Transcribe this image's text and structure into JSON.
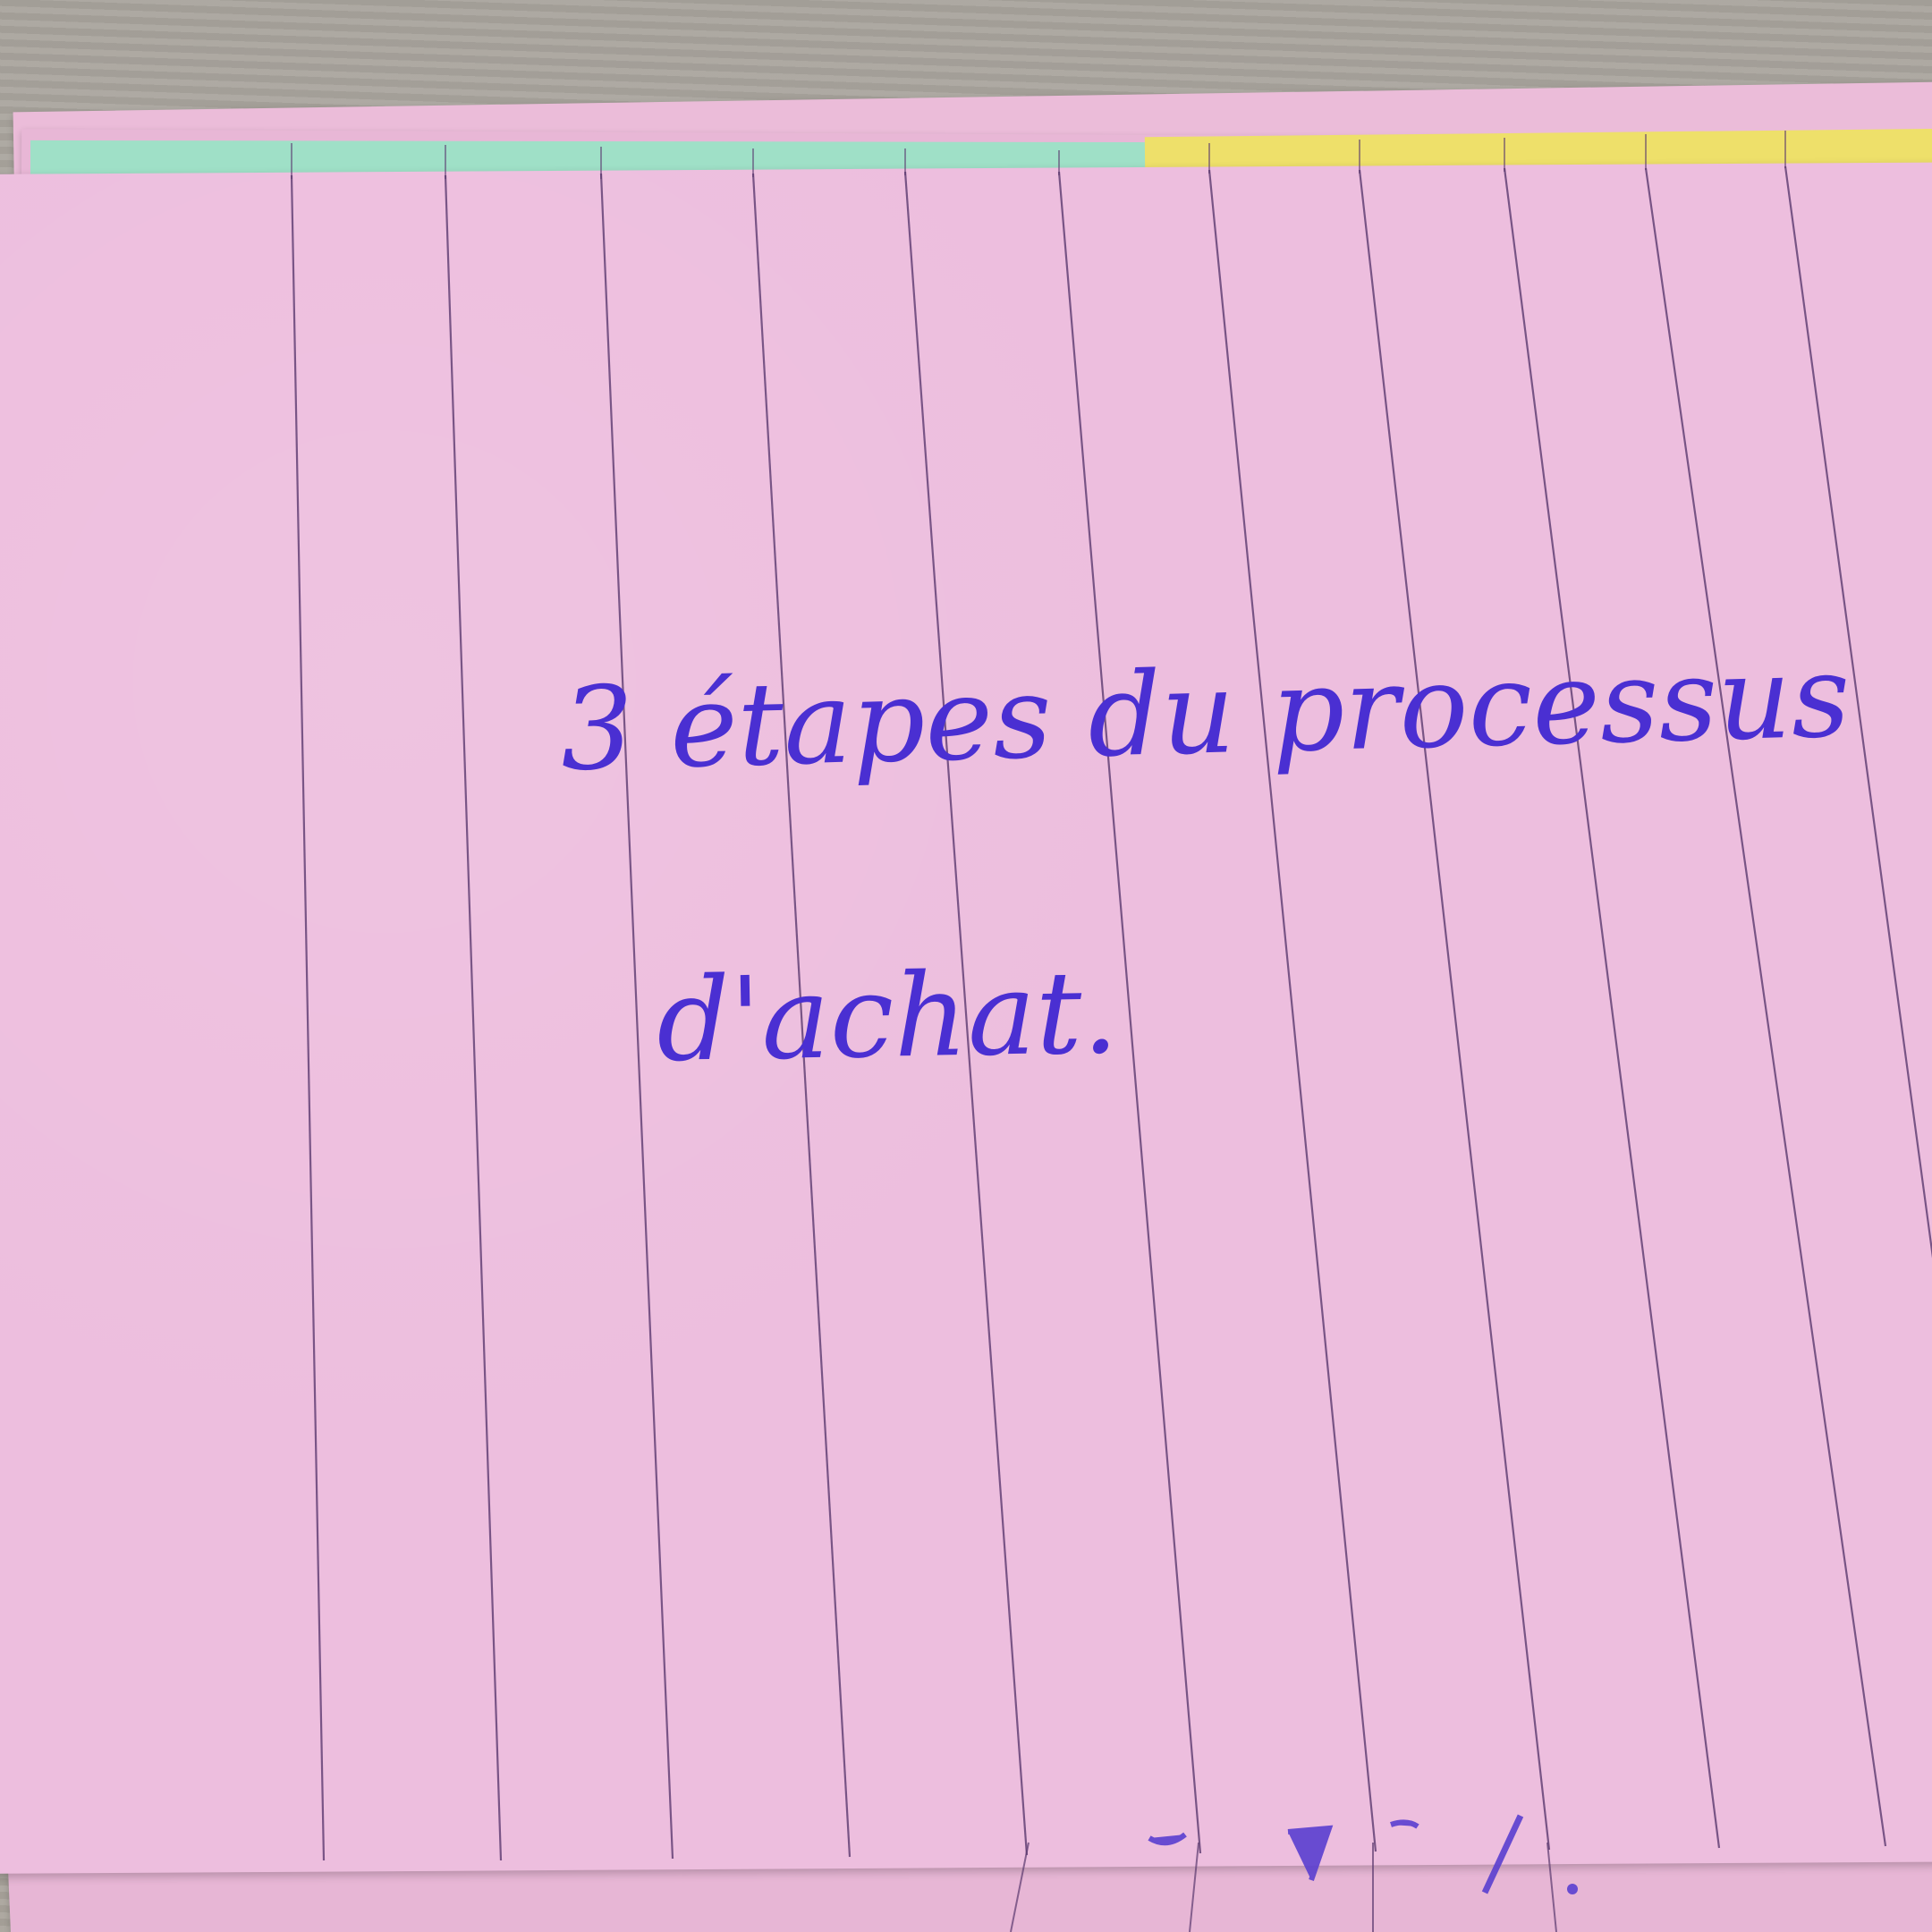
{
  "card": {
    "line1": "3 étapes du processus",
    "line2": "d'achat."
  },
  "colors": {
    "card_pink": "#edbede",
    "ink_blue": "#4a2fd2",
    "tab_green": "#9fe0c7",
    "tab_yellow": "#eee06a",
    "table_gray": "#aea89f"
  }
}
